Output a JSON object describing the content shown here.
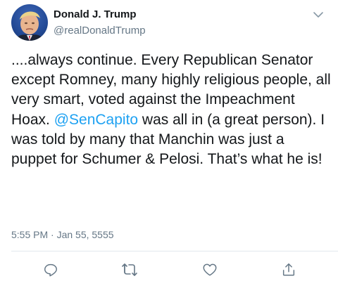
{
  "author": {
    "name": "Donald J. Trump",
    "handle": "@realDonaldTrump"
  },
  "tweet": {
    "text_before_mention": "....always continue. Every Republican Senator except Romney, many highly religious people, all very smart, voted against the Impeachment Hoax. ",
    "mention": "@SenCapito",
    "text_after_mention": " was all in (a great person). I was told by many that Manchin was just a puppet for Schumer & Pelosi. That’s what he is!",
    "timestamp": "5:55 PM · Jan 55, 5555"
  },
  "icons": {
    "menu": "chevron-down-icon",
    "reply": "reply-icon",
    "retweet": "retweet-icon",
    "like": "heart-icon",
    "share": "share-icon"
  },
  "colors": {
    "mention": "#1da1f2",
    "secondary_text": "#657786",
    "icon": "#657786",
    "divider": "#e1e8ed"
  }
}
